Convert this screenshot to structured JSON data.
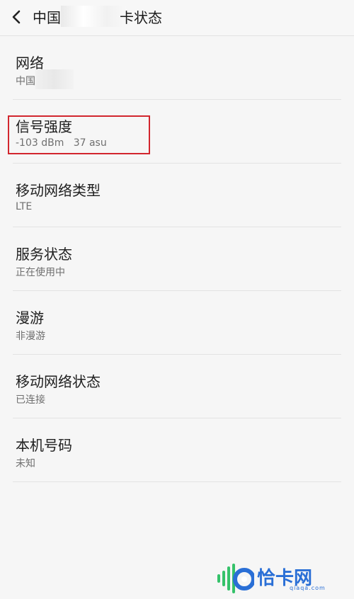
{
  "header": {
    "title_prefix": "中国",
    "title_suffix": "卡状态"
  },
  "items": [
    {
      "title": "网络",
      "subtitle": "中国"
    },
    {
      "title": "信号强度",
      "subtitle": "-103 dBm   37 asu"
    },
    {
      "title": "移动网络类型",
      "subtitle": "LTE"
    },
    {
      "title": "服务状态",
      "subtitle": "正在使用中"
    },
    {
      "title": "漫游",
      "subtitle": "非漫游"
    },
    {
      "title": "移动网络状态",
      "subtitle": "已连接"
    },
    {
      "title": "本机号码",
      "subtitle": "未知"
    }
  ],
  "watermark": {
    "brand": "恰卡网",
    "domain": "qiaqa.com"
  },
  "colors": {
    "highlight": "#d2262e",
    "watermark": "#2a6fd6",
    "background": "#f6f6f6"
  }
}
